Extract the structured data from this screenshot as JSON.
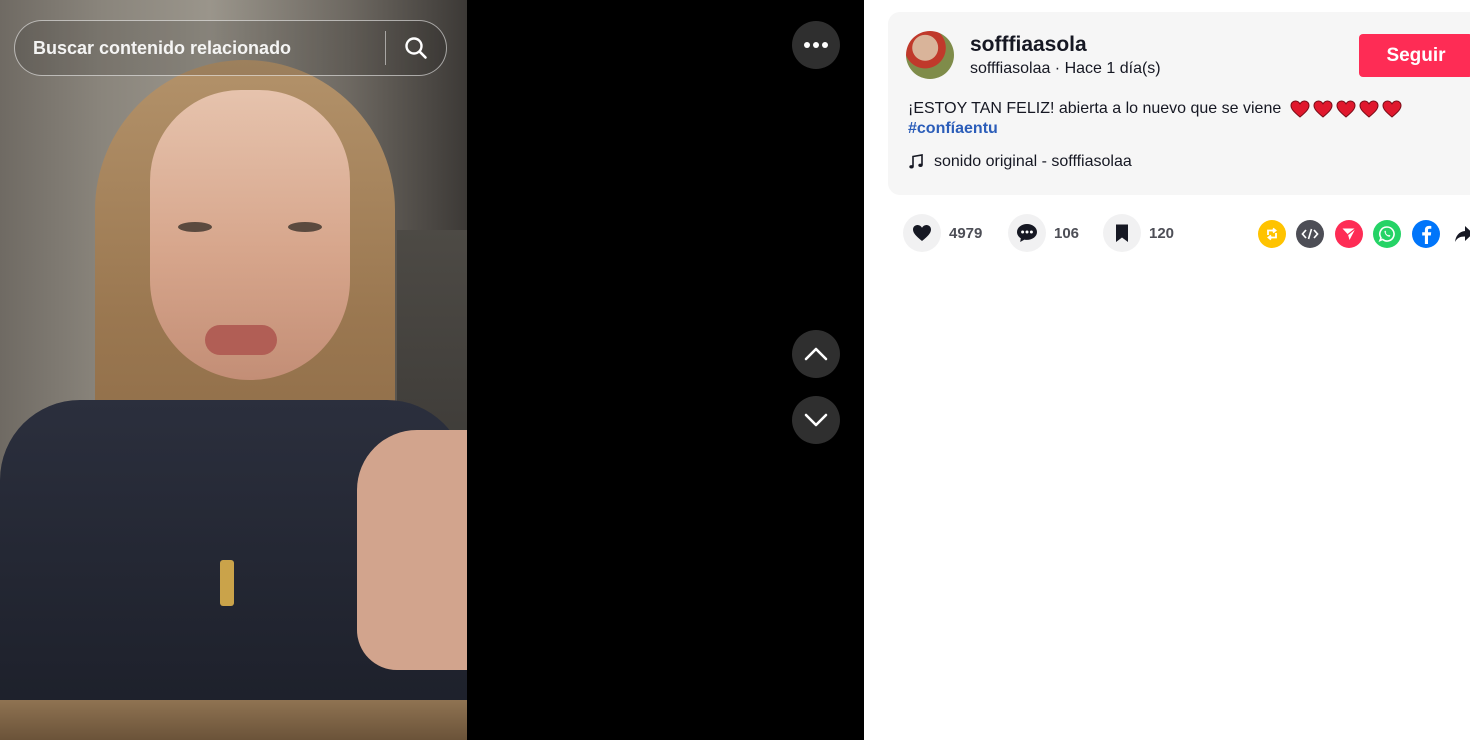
{
  "search": {
    "placeholder": "Buscar contenido relacionado"
  },
  "video": {
    "more_icon": "more-horizontal-icon",
    "prev_icon": "chevron-up-icon",
    "next_icon": "chevron-down-icon"
  },
  "author": {
    "display_name": "sofffiaasola",
    "meta": "sofffiasolaa · Hace 1 día(s)",
    "follow_label": "Seguir"
  },
  "post": {
    "caption": "¡ESTOY TAN FELIZ! abierta a lo nuevo que se viene",
    "hashtag": "#confíaentu",
    "sound": "sonido original - sofffiasolaa"
  },
  "stats": {
    "likes": "4979",
    "comments": "106",
    "saves": "120"
  },
  "share": {
    "icons": [
      "repost-icon",
      "embed-icon",
      "send-icon",
      "whatsapp-icon",
      "facebook-icon",
      "share-arrow-icon"
    ]
  },
  "colors": {
    "accent": "#fe2c55",
    "hashtag": "#2b5db9",
    "repost": "#ffc300",
    "embed": "#4d4e56",
    "send": "#fe2c55",
    "whatsapp": "#25d366",
    "facebook": "#0075fa"
  }
}
